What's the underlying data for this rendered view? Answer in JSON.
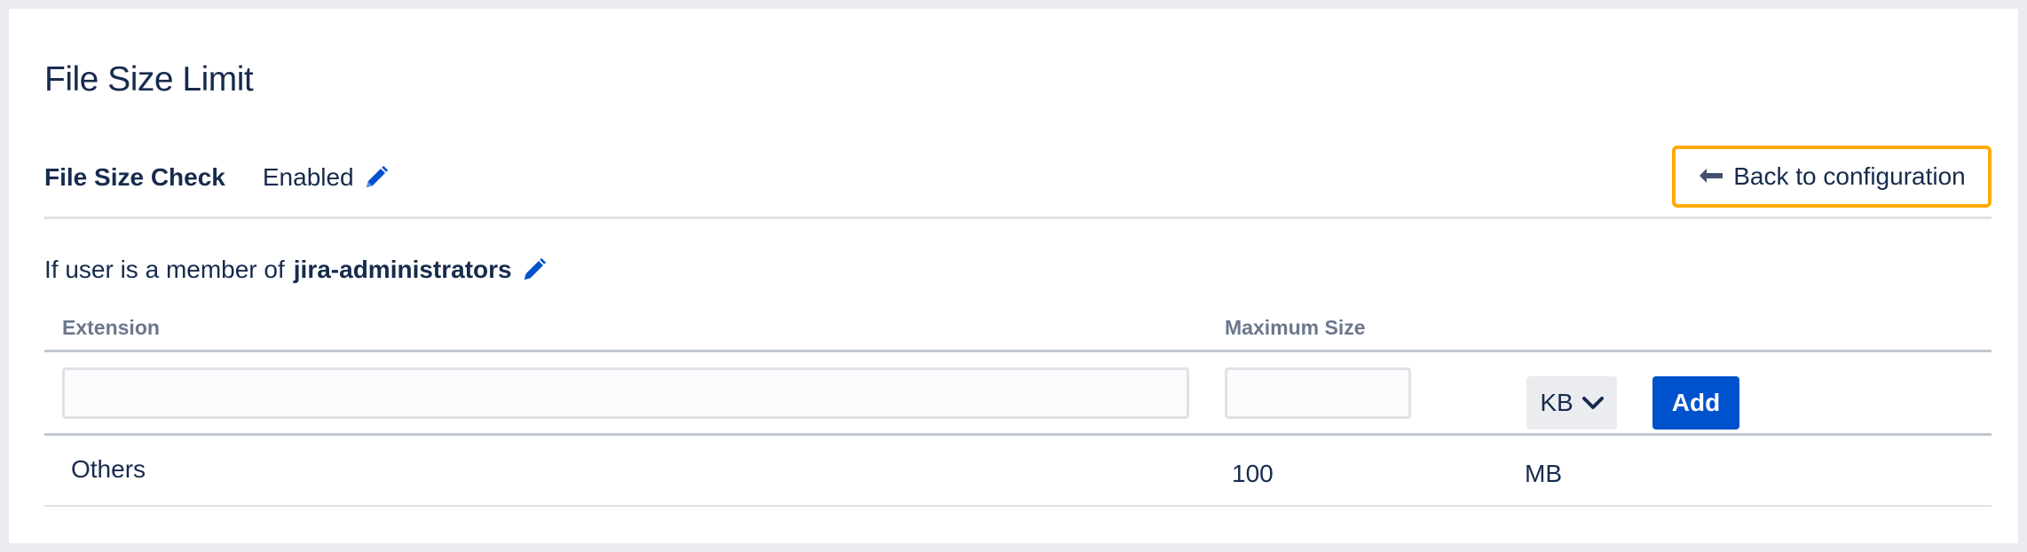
{
  "page": {
    "title": "File Size Limit"
  },
  "file_size_check": {
    "label": "File Size Check",
    "value": "Enabled",
    "edit_icon": "pencil-icon"
  },
  "back_button": {
    "label": "Back to configuration",
    "icon": "back-arrow-icon"
  },
  "condition": {
    "prefix": "If user is a member of",
    "group": "jira-administrators",
    "edit_icon": "pencil-icon"
  },
  "table": {
    "columns": [
      "Extension",
      "Maximum Size"
    ],
    "new_row": {
      "extension_value": "",
      "size_value": "",
      "unit": "KB",
      "add_label": "Add"
    },
    "rows": [
      {
        "extension": "Others",
        "size": "100",
        "unit": "MB"
      }
    ]
  },
  "colors": {
    "accent": "#0052cc",
    "focus_ring": "#ffab00",
    "text": "#172b4d",
    "muted": "#6b778c"
  }
}
